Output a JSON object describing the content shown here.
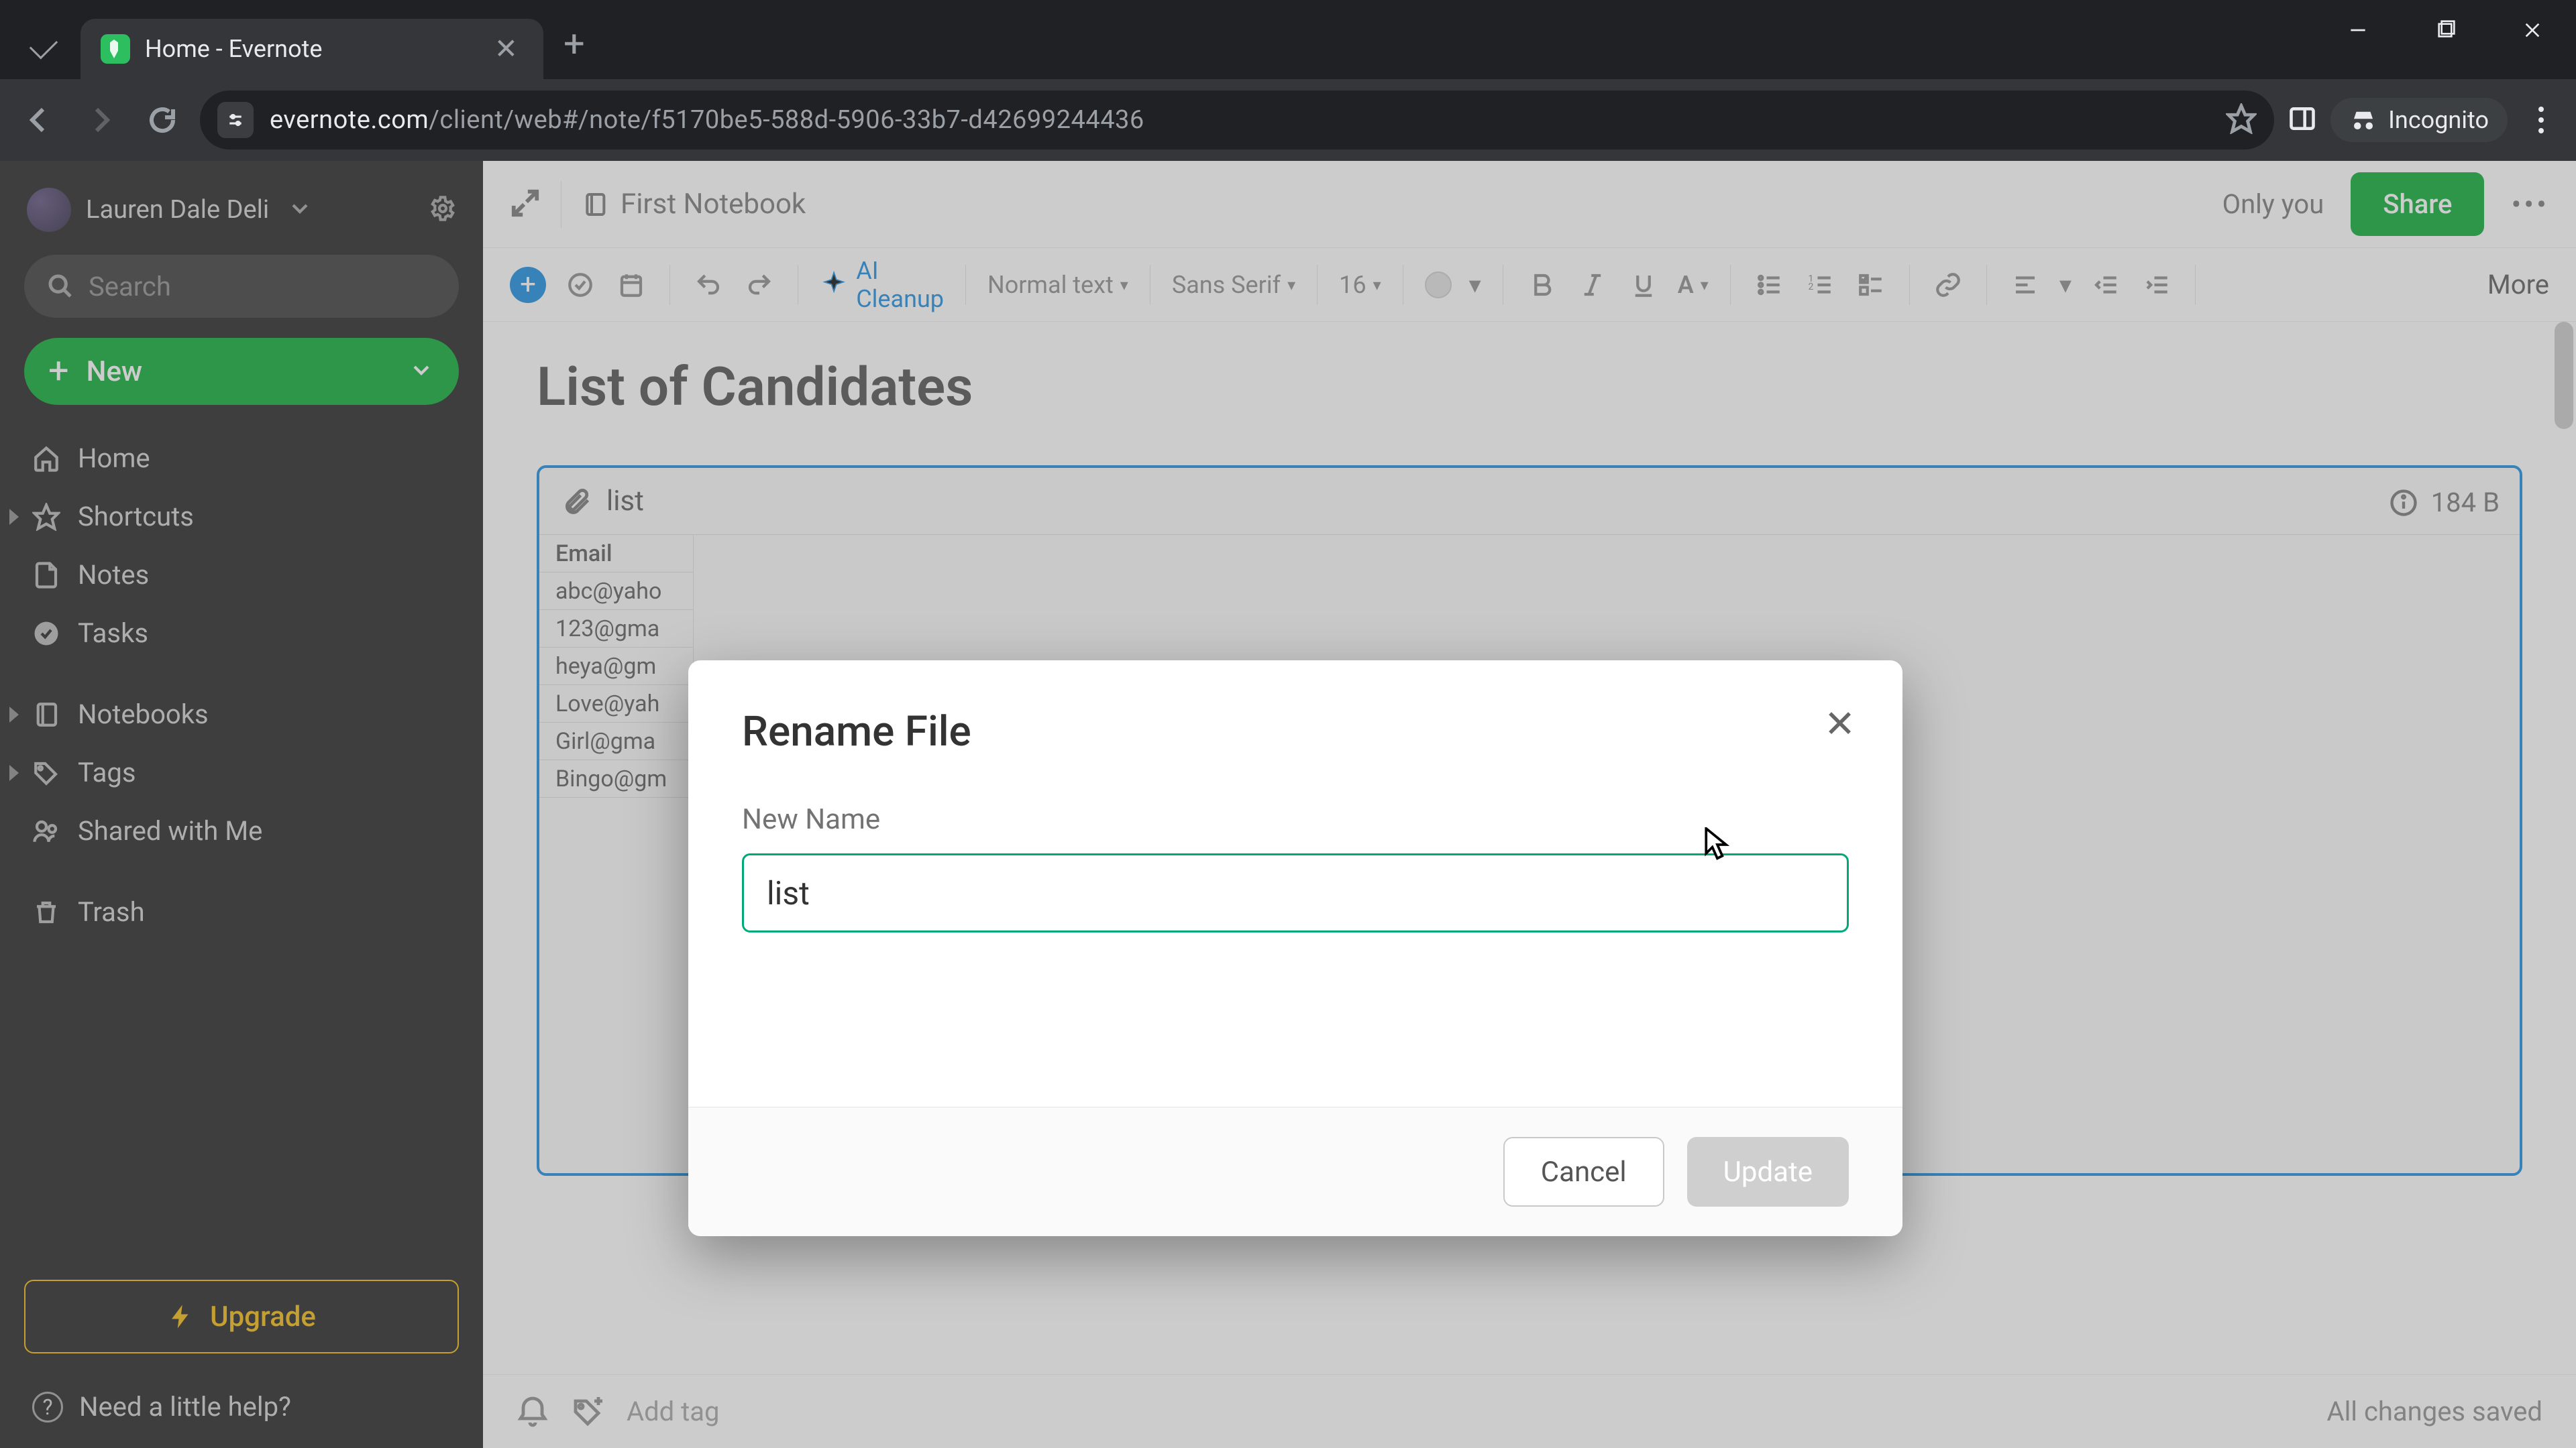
{
  "browser": {
    "tab_title": "Home - Evernote",
    "url_host": "evernote.com",
    "url_path": "/client/web#/note/f5170be5-588d-5906-33b7-d42699244436",
    "incognito": "Incognito"
  },
  "sidebar": {
    "user": "Lauren Dale Deli",
    "search_placeholder": "Search",
    "new_label": "New",
    "items": {
      "home": "Home",
      "shortcuts": "Shortcuts",
      "notes": "Notes",
      "tasks": "Tasks",
      "notebooks": "Notebooks",
      "tags": "Tags",
      "shared": "Shared with Me",
      "trash": "Trash"
    },
    "upgrade": "Upgrade",
    "help": "Need a little help?"
  },
  "topbar": {
    "notebook": "First Notebook",
    "only_you": "Only you",
    "share": "Share"
  },
  "toolbar": {
    "ai": "AI Cleanup",
    "style": "Normal text",
    "font": "Sans Serif",
    "size": "16",
    "more": "More"
  },
  "note": {
    "title": "List of Candidates",
    "attachment": {
      "filename": "list",
      "size": "184 B",
      "rows": [
        "Email",
        "abc@yaho",
        "123@gma",
        "heya@gm",
        "Love@yah",
        "Girl@gma",
        "Bingo@gm"
      ]
    }
  },
  "footer": {
    "add_tag": "Add tag",
    "saved": "All changes saved"
  },
  "modal": {
    "title": "Rename File",
    "field_label": "New Name",
    "value": "list",
    "cancel": "Cancel",
    "update": "Update"
  }
}
